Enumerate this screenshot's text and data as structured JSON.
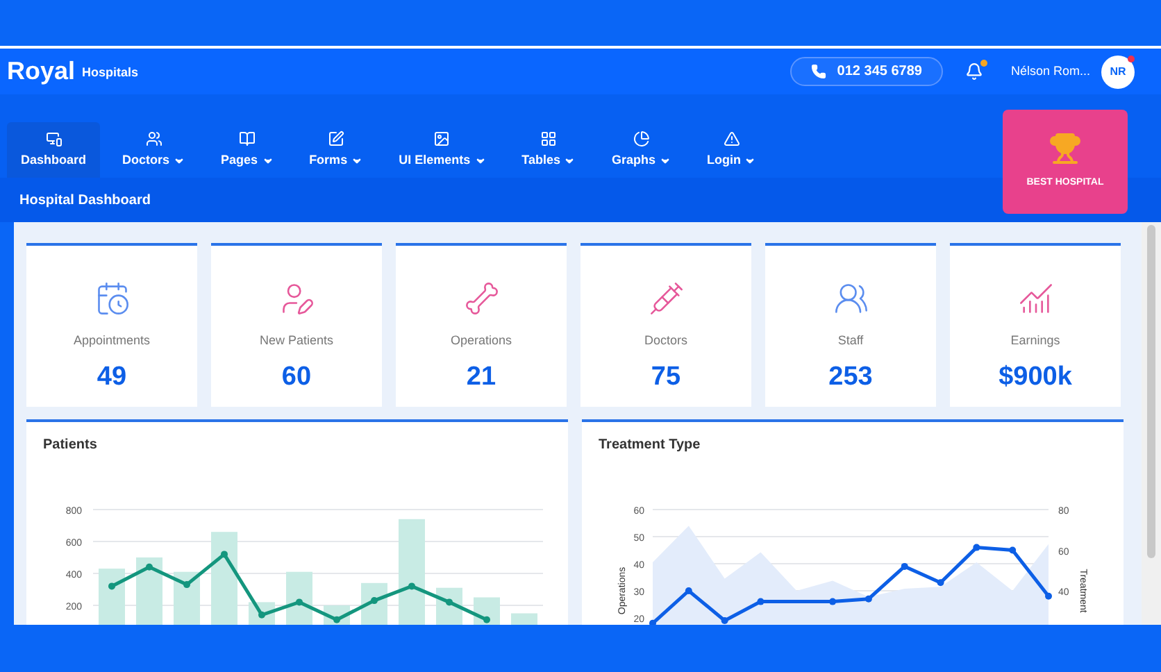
{
  "brand": {
    "name": "Royal",
    "subtitle": "Hospitals"
  },
  "header": {
    "phone": "012 345 6789",
    "user_name": "Nélson Rom...",
    "avatar_initials": "NR"
  },
  "nav": [
    {
      "label": "Dashboard",
      "dropdown": false,
      "selected": true
    },
    {
      "label": "Doctors",
      "dropdown": true,
      "selected": false
    },
    {
      "label": "Pages",
      "dropdown": true,
      "selected": false
    },
    {
      "label": "Forms",
      "dropdown": true,
      "selected": false
    },
    {
      "label": "UI Elements",
      "dropdown": true,
      "selected": false
    },
    {
      "label": "Tables",
      "dropdown": true,
      "selected": false
    },
    {
      "label": "Graphs",
      "dropdown": true,
      "selected": false
    },
    {
      "label": "Login",
      "dropdown": true,
      "selected": false
    }
  ],
  "award": {
    "label": "BEST HOSPITAL"
  },
  "page_title": "Hospital Dashboard",
  "stats": [
    {
      "label": "Appointments",
      "value": "49"
    },
    {
      "label": "New Patients",
      "value": "60"
    },
    {
      "label": "Operations",
      "value": "21"
    },
    {
      "label": "Doctors",
      "value": "75"
    },
    {
      "label": "Staff",
      "value": "253"
    },
    {
      "label": "Earnings",
      "value": "$900k"
    }
  ],
  "charts": [
    {
      "title": "Patients",
      "chart_data": {
        "type": "bar",
        "grid": true,
        "ylim": [
          0,
          800
        ],
        "yticks": [
          200,
          400,
          600,
          800
        ],
        "series": [
          {
            "type": "bar",
            "color": "#c8ebe4",
            "values": [
              430,
              500,
              410,
              660,
              220,
              410,
              200,
              340,
              740,
              310,
              250,
              150
            ]
          },
          {
            "type": "line",
            "marker": true,
            "color": "#14967e",
            "values": [
              320,
              440,
              330,
              520,
              140,
              220,
              110,
              230,
              320,
              220,
              110,
              null
            ]
          }
        ]
      }
    },
    {
      "title": "Treatment Type",
      "chart_data": {
        "type": "line",
        "grid": true,
        "ylabel": "Operations",
        "y2label": "Treatment",
        "ylim": [
          0,
          60
        ],
        "yticks": [
          20,
          30,
          40,
          50,
          60
        ],
        "y2lim": [
          0,
          80
        ],
        "y2ticks": [
          40,
          60,
          80
        ],
        "series": [
          {
            "type": "area",
            "axis": "y2",
            "color": "#e3ecfb",
            "values": [
              54,
              72,
              46,
              59,
              40,
              45,
              37,
              41,
              42,
              54,
              40,
              63
            ]
          },
          {
            "type": "line",
            "marker": true,
            "color": "#0d5fe6",
            "values": [
              18,
              30,
              19,
              26,
              null,
              26,
              27,
              39,
              33,
              46,
              45,
              28
            ]
          }
        ]
      }
    }
  ]
}
